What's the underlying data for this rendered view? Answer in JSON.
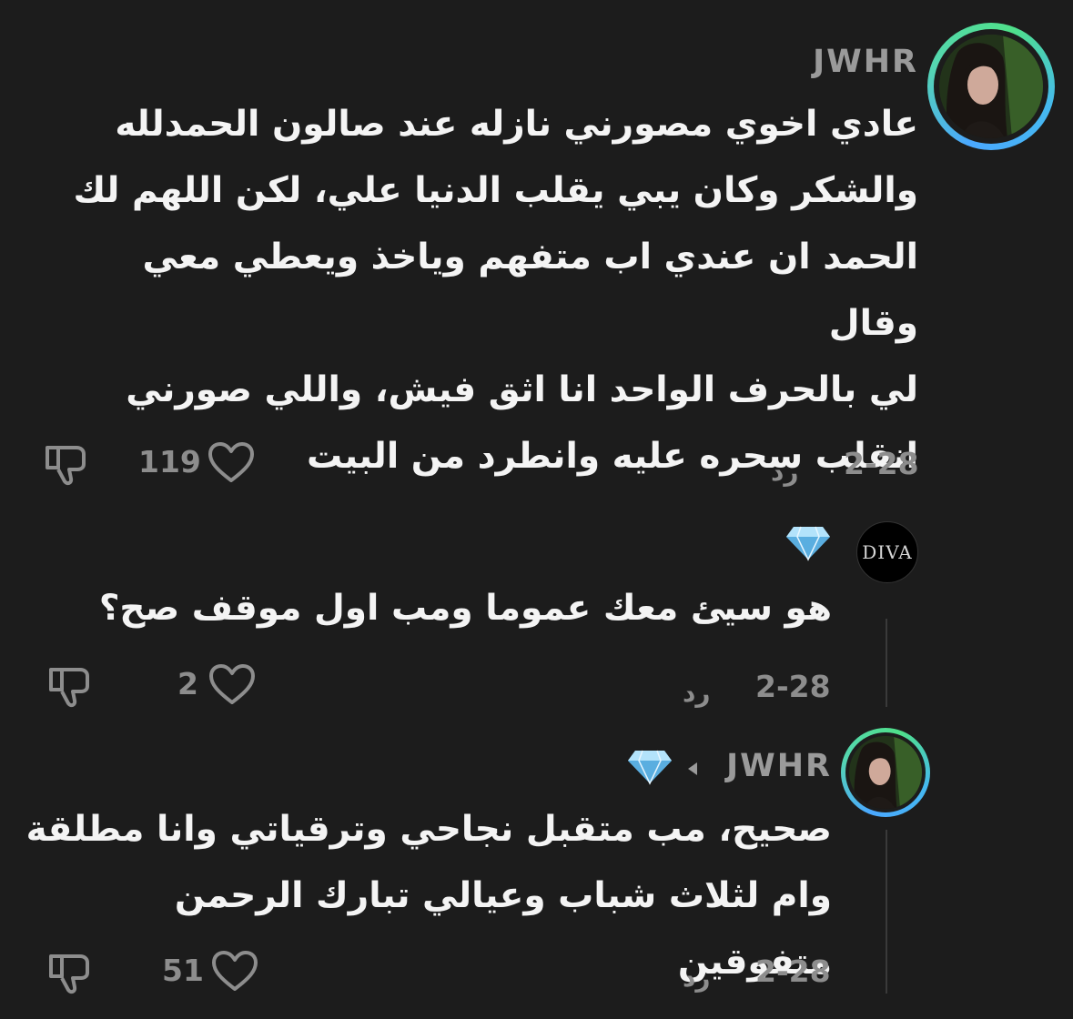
{
  "comments": [
    {
      "username": "JWHR",
      "avatar_icon": "profile-photo",
      "text": "عادي اخوي مصورني نازله عند صالون الحمدلله\nوالشكر وكان يبي يقلب الدنيا علي، لكن اللهم لك\nالحمد ان عندي اب متفهم وياخذ ويعطي معي وقال\nلي بالحرف الواحد انا اثق فيش، واللي صورني\nانقلب سحره عليه وانطرد من البيت",
      "date": "2-28",
      "reply_label": "رد",
      "likes": "119"
    },
    {
      "username": "",
      "avatar_text": "DIVA",
      "badge_icon": "gem-icon",
      "text": "هو سيئ معك عموما ومب اول موقف صح؟",
      "date": "2-28",
      "reply_label": "رد",
      "likes": "2"
    },
    {
      "username": "JWHR",
      "avatar_icon": "profile-photo",
      "reply_to_icon": "gem-icon",
      "text": "صحيح، مب متقبل نجاحي وترقياتي وانا مطلقة\nوام لثلاث شباب وعيالي تبارك الرحمن متفوقين",
      "date": "2-28",
      "reply_label": "رد",
      "likes": "51"
    }
  ],
  "colors": {
    "background": "#1c1c1c",
    "text": "#f4f4f4",
    "muted": "#8d8d8d",
    "gem": "#7cc8f0"
  }
}
